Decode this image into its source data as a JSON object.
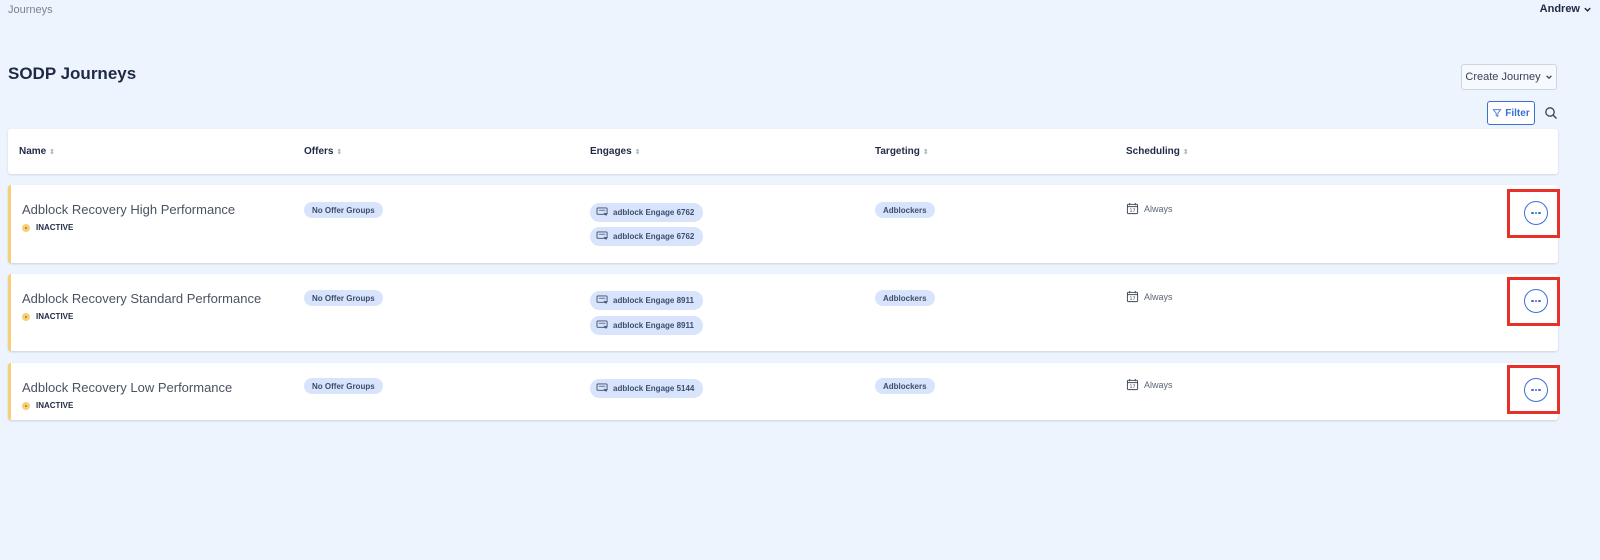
{
  "breadcrumb": "Journeys",
  "user": {
    "name": "Andrew"
  },
  "page_title": "SODP Journeys",
  "toolbar": {
    "create_label": "Create Journey",
    "filter_label": "Filter"
  },
  "columns": {
    "name": "Name",
    "offers": "Offers",
    "engages": "Engages",
    "targeting": "Targeting",
    "scheduling": "Scheduling"
  },
  "rows": [
    {
      "name": "Adblock Recovery High Performance",
      "status": "INACTIVE",
      "offer": "No Offer Groups",
      "engages": [
        "adblock Engage 6762",
        "adblock Engage 6762"
      ],
      "targeting": "Adblockers",
      "schedule": "Always"
    },
    {
      "name": "Adblock Recovery Standard Performance",
      "status": "INACTIVE",
      "offer": "No Offer Groups",
      "engages": [
        "adblock Engage 8911",
        "adblock Engage 8911"
      ],
      "targeting": "Adblockers",
      "schedule": "Always"
    },
    {
      "name": "Adblock Recovery Low Performance",
      "status": "INACTIVE",
      "offer": "No Offer Groups",
      "engages": [
        "adblock Engage 5144"
      ],
      "targeting": "Adblockers",
      "schedule": "Always"
    }
  ],
  "icons": {
    "user_menu": "chevron-down-icon",
    "create": "chevron-down-icon",
    "filter": "filter-funnel-icon",
    "search": "search-icon",
    "engage": "engage-message-icon",
    "schedule": "calendar-icon",
    "more": "ellipsis-icon"
  },
  "colors": {
    "background": "#edf4fe",
    "accent": "#3b6fd6",
    "status_inactive": "#f5d077",
    "pill": "#d7e4fb",
    "highlight": "#e8302b"
  }
}
